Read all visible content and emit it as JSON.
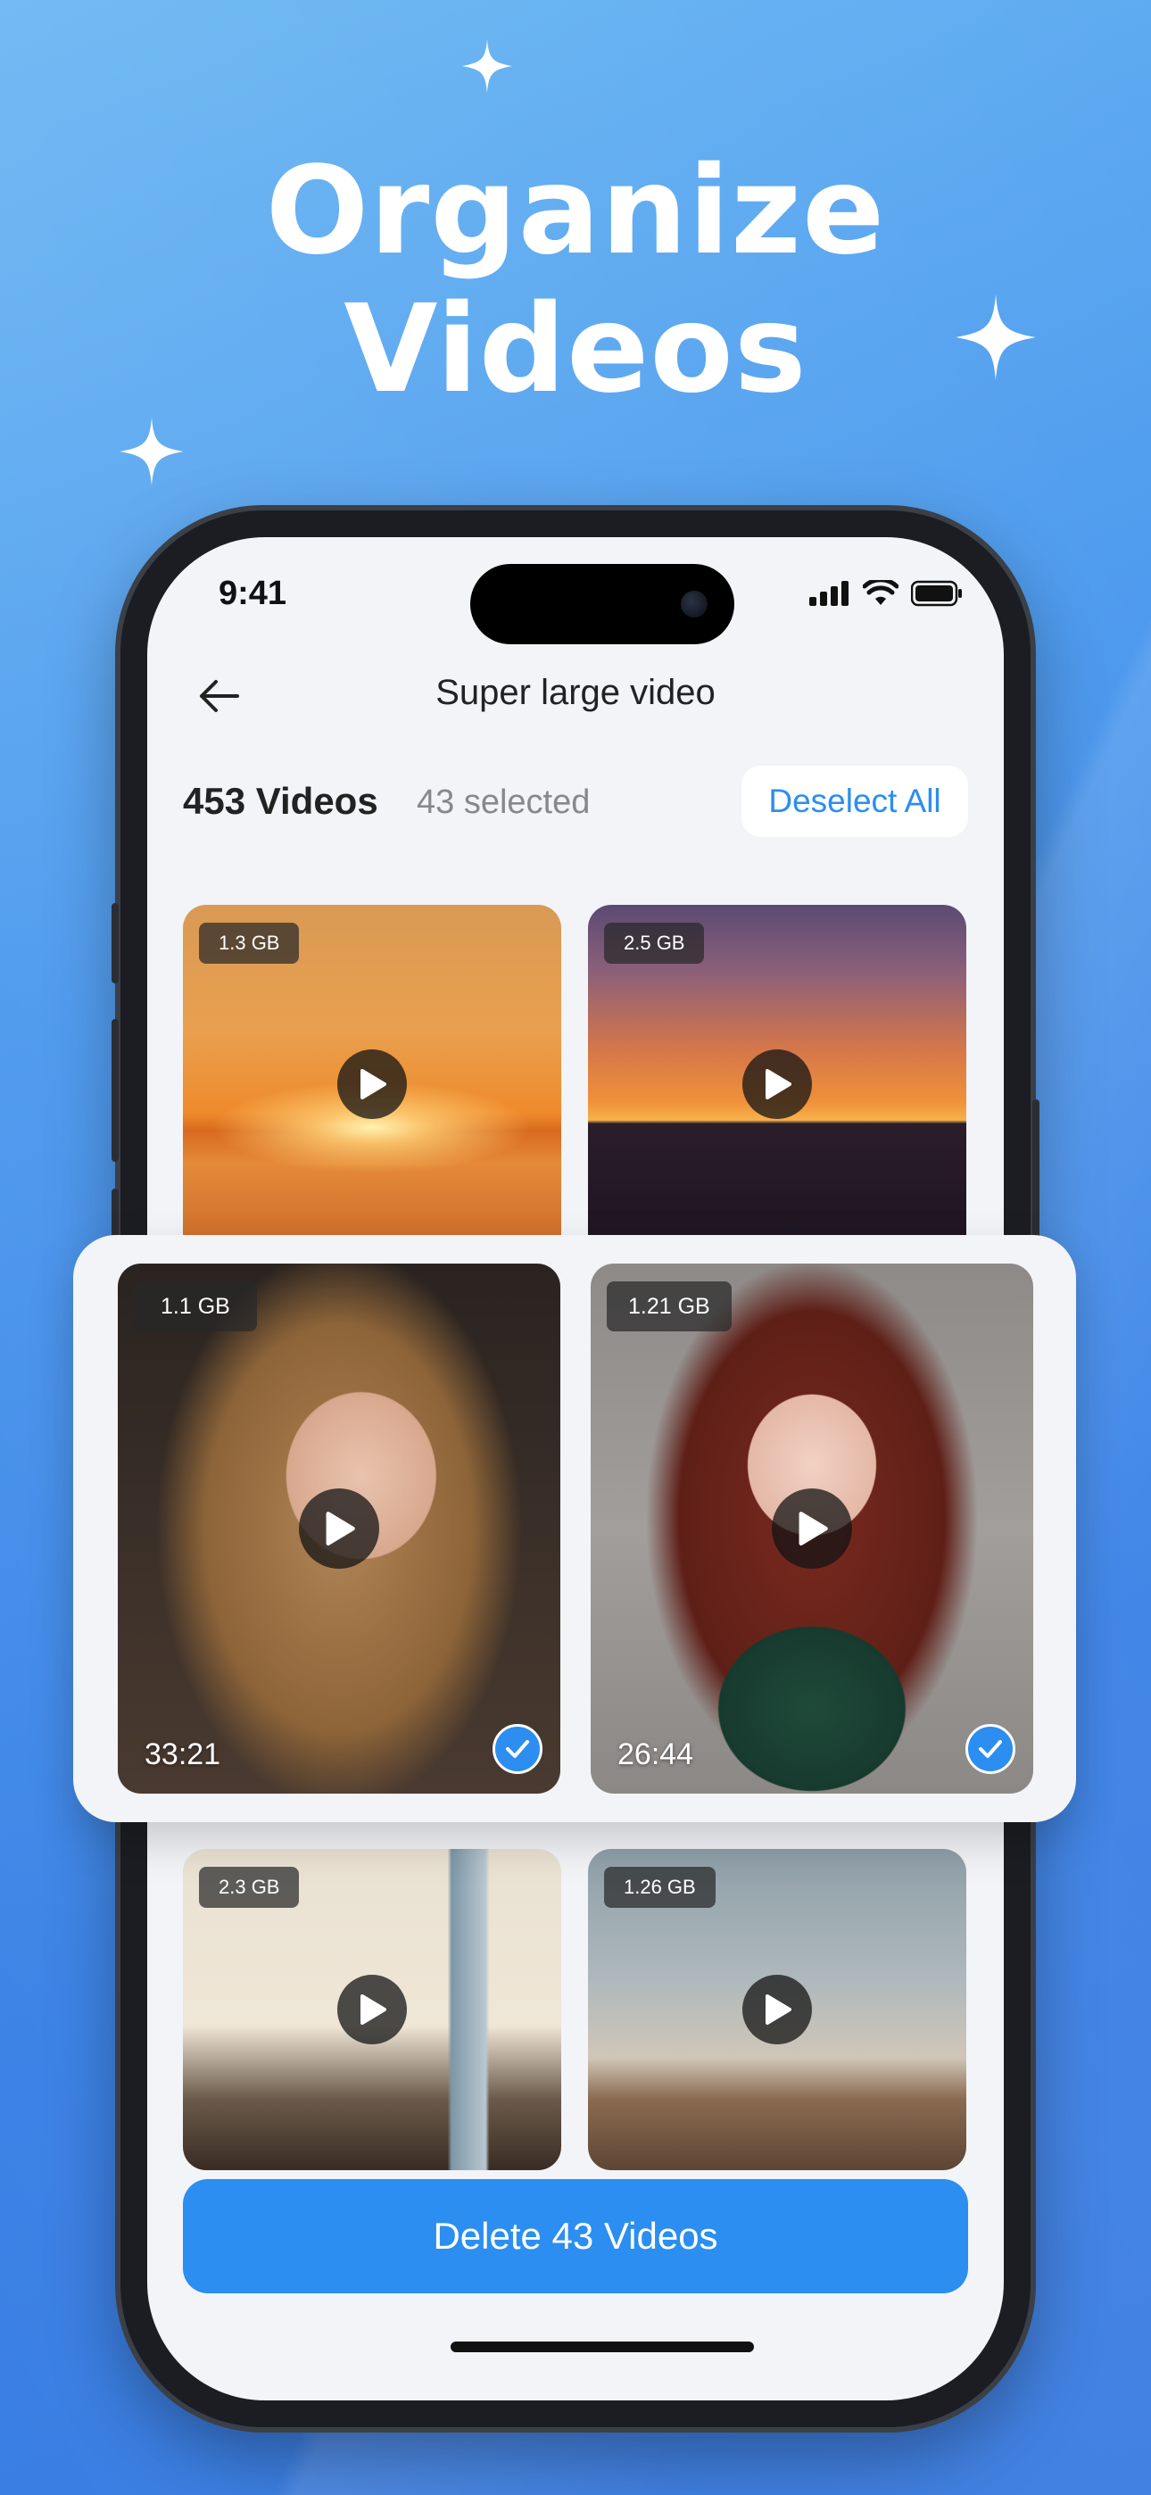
{
  "headline": {
    "line1": "Organize",
    "line2": "Videos"
  },
  "status_bar": {
    "time": "9:41"
  },
  "nav": {
    "title": "Super large video"
  },
  "summary": {
    "count_label": "453 Videos",
    "selected_label": "43 selected",
    "deselect_label": "Deselect All"
  },
  "videos": [
    {
      "size": "1.3 GB",
      "scene": "sunset over sea"
    },
    {
      "size": "2.5 GB",
      "scene": "mountain sunset"
    },
    {
      "size": "1.1 GB",
      "duration": "33:21",
      "selected": true,
      "scene": "blonde woman portrait"
    },
    {
      "size": "1.21 GB",
      "duration": "26:44",
      "selected": true,
      "scene": "red-haired woman portrait"
    },
    {
      "size": "2.3 GB",
      "scene": "couple in cafe"
    },
    {
      "size": "1.26 GB",
      "scene": "desert rocks at dusk"
    }
  ],
  "delete_button": {
    "label": "Delete 43 Videos"
  },
  "colors": {
    "accent": "#2b8ef0",
    "background_top": "#6cb8f3",
    "background_bottom": "#3a7be0"
  }
}
